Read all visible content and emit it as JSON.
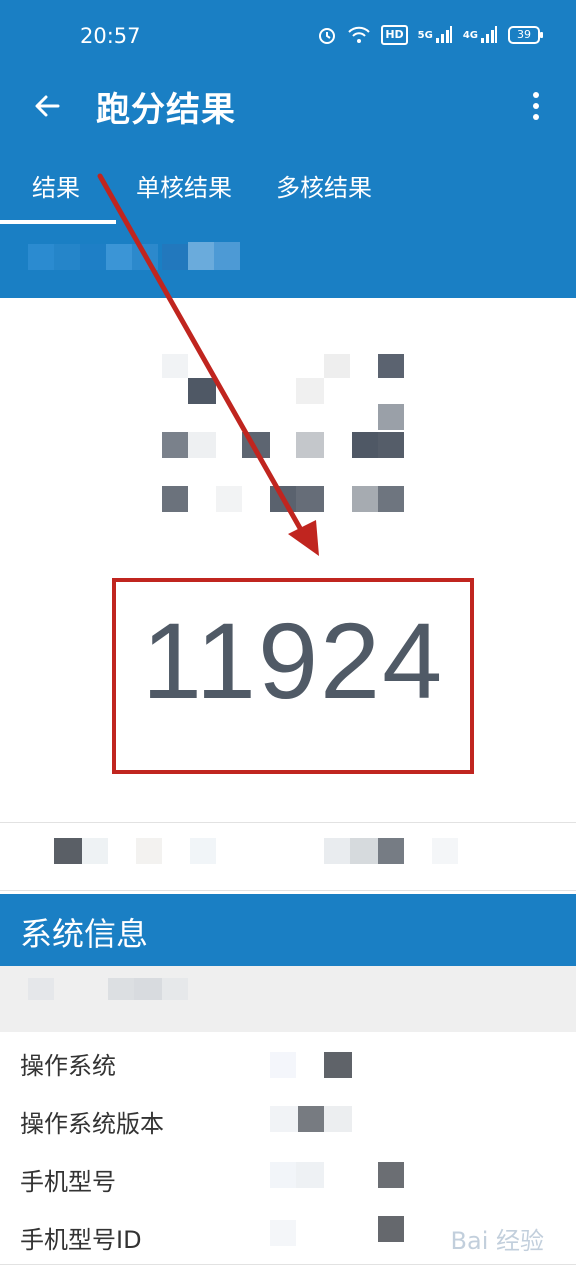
{
  "status_bar": {
    "time": "20:57",
    "network_hd": "HD",
    "network_5g": "5G",
    "network_4g": "4G",
    "battery": "39"
  },
  "app_bar": {
    "title": "跑分结果"
  },
  "tabs": [
    {
      "label": "结果",
      "active": true
    },
    {
      "label": "单核结果",
      "active": false
    },
    {
      "label": "多核结果",
      "active": false
    }
  ],
  "score": {
    "value": "11924"
  },
  "section": {
    "title": "系统信息"
  },
  "info_rows": [
    {
      "label": "操作系统"
    },
    {
      "label": "操作系统版本"
    },
    {
      "label": "手机型号"
    },
    {
      "label": "手机型号ID"
    }
  ],
  "colors": {
    "primary": "#1a7fc4",
    "score_text": "#505a66",
    "highlight_box": "#c0251f"
  },
  "watermark": "Bai 经验"
}
